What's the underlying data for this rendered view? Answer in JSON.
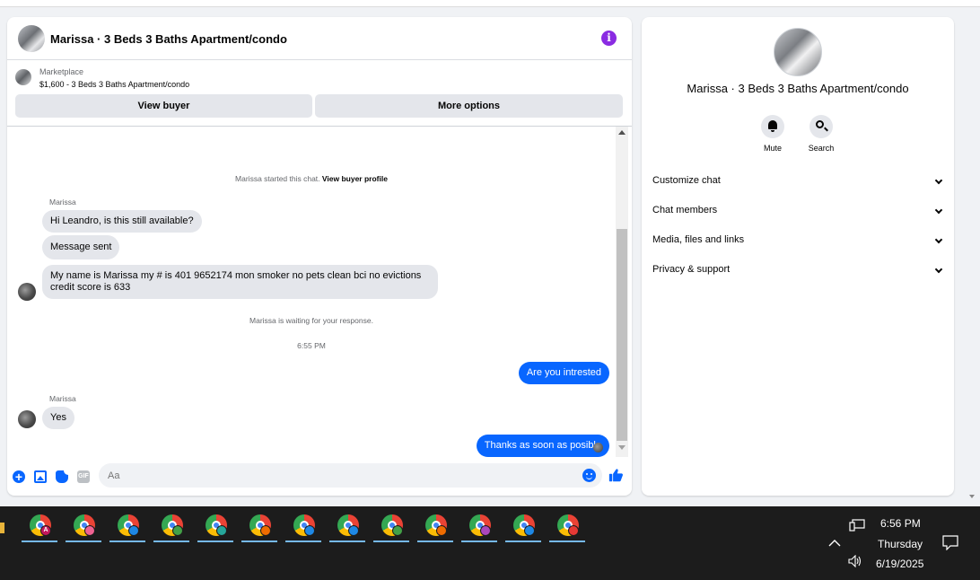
{
  "chat": {
    "title": "Marissa · 3 Beds 3 Baths Apartment/condo",
    "marketplace_label": "Marketplace",
    "listing": "$1,600 - 3 Beds 3 Baths Apartment/condo",
    "view_buyer_label": "View buyer",
    "more_options_label": "More options",
    "started_text": "Marissa started this chat. ",
    "view_buyer_profile_label": "View buyer profile",
    "sender_name": "Marissa",
    "messages": [
      "Hi Leandro, is this still available?",
      "Message sent",
      "My name is Marissa my # is 401 9652174 mon smoker no pets clean bci no evictions",
      "credit score is 633"
    ],
    "waiting_text": "Marissa is waiting for your response.",
    "timestamp": "6:55 PM",
    "sent_1": "Are you intrested",
    "sender_name_2": "Marissa",
    "reply": "Yes",
    "sent_2": "Thanks as soon as posible",
    "input_placeholder": "Aa",
    "gif_label": "GIF"
  },
  "details": {
    "title": "Marissa · 3 Beds 3 Baths Apartment/condo",
    "mute_label": "Mute",
    "search_label": "Search",
    "rows": [
      "Customize chat",
      "Chat members",
      "Media, files and links",
      "Privacy & support"
    ]
  },
  "taskbar": {
    "time": "6:56 PM",
    "day": "Thursday",
    "date": "6/19/2025",
    "first_profile_letter": "A",
    "profile_colors": [
      "#c2185b",
      "#f06292",
      "#1e88e5",
      "#43a047",
      "#26a69a",
      "#ef6c00",
      "#1e88e5",
      "#1e88e5",
      "#43a047",
      "#ef6c00",
      "#ab47bc",
      "#1e88e5",
      "#e53935"
    ]
  },
  "colors": {
    "accent": "#0866ff",
    "info_purple": "#8a2be2",
    "bubble_gray": "#e4e6eb"
  }
}
